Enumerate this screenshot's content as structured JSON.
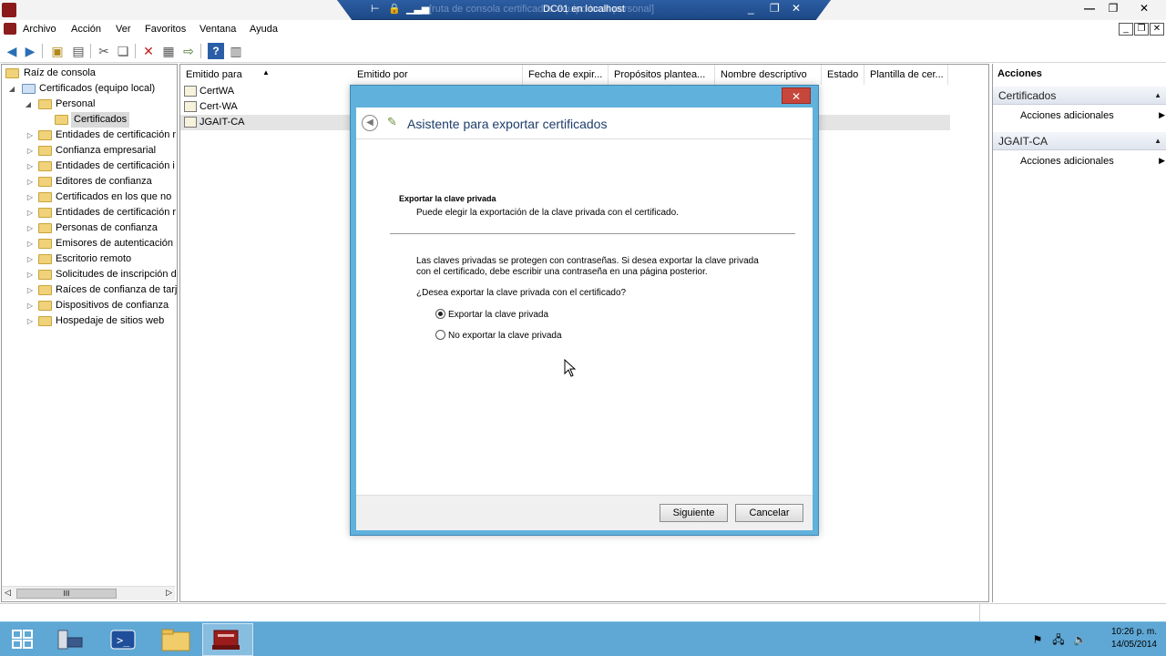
{
  "rdp": {
    "title": "DC01 en localhost",
    "ghost_text": "[ruta de consola certificados equipo local personal]"
  },
  "menu": {
    "items": [
      "Archivo",
      "Acción",
      "Ver",
      "Favoritos",
      "Ventana",
      "Ayuda"
    ]
  },
  "tree": {
    "root": "Raíz de consola",
    "computer": "Certificados (equipo local)",
    "personal": "Personal",
    "selected": "Certificados",
    "stores": [
      "Entidades de certificación r",
      "Confianza empresarial",
      "Entidades de certificación i",
      "Editores de confianza",
      "Certificados en los que no",
      "Entidades de certificación r",
      "Personas de confianza",
      "Emisores de autenticación",
      "Escritorio remoto",
      "Solicitudes de inscripción d",
      "Raíces de confianza de tarj",
      "Dispositivos de confianza",
      "Hospedaje de sitios web"
    ],
    "scroll_grip": "III"
  },
  "list": {
    "columns": [
      "Emitido para",
      "Emitido por",
      "Fecha de expir...",
      "Propósitos plantea...",
      "Nombre descriptivo",
      "Estado",
      "Plantilla de cer..."
    ],
    "rows": [
      "CertWA",
      "Cert-WA",
      "JGAIT-CA"
    ]
  },
  "actions": {
    "title": "Acciones",
    "sections": [
      {
        "header": "Certificados",
        "item": "Acciones adicionales"
      },
      {
        "header": "JGAIT-CA",
        "item": "Acciones adicionales"
      }
    ]
  },
  "dialog": {
    "title": "Asistente para exportar certificados",
    "section_title": "Exportar la clave privada",
    "section_subtitle": "Puede elegir la exportación de la clave privada con el certificado.",
    "body_line1": "Las claves privadas se protegen con contraseñas. Si desea exportar la clave privada",
    "body_line2": "con el certificado, debe escribir una contraseña en una página posterior.",
    "question": "¿Desea exportar la clave privada con el certificado?",
    "option_export": "Exportar la clave privada",
    "option_no_export": "No exportar la clave privada",
    "selected_option": "export",
    "next_button": "Siguiente",
    "cancel_button": "Cancelar",
    "close_glyph": "✕"
  },
  "taskbar": {
    "time": "10:26 p. m.",
    "date": "14/05/2014"
  }
}
